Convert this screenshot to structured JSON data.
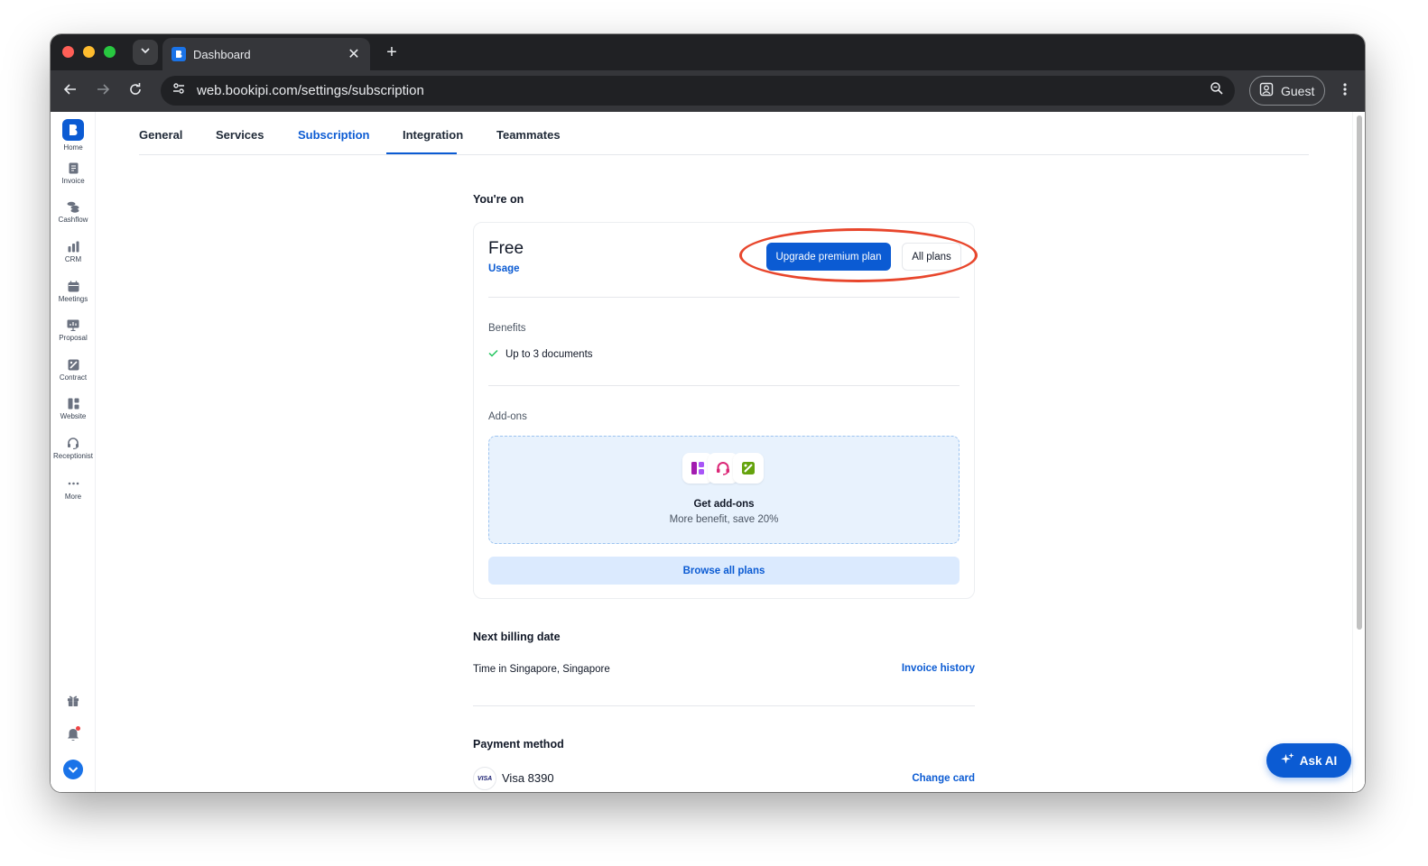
{
  "browser": {
    "tab_title": "Dashboard",
    "url": "web.bookipi.com/settings/subscription",
    "profile_label": "Guest"
  },
  "sidebar": {
    "items": [
      {
        "label": "Home",
        "icon": "bookipi-logo-icon"
      },
      {
        "label": "Invoice",
        "icon": "invoice-icon"
      },
      {
        "label": "Cashflow",
        "icon": "cashflow-icon"
      },
      {
        "label": "CRM",
        "icon": "crm-icon"
      },
      {
        "label": "Meetings",
        "icon": "meetings-icon"
      },
      {
        "label": "Proposal",
        "icon": "proposal-icon"
      },
      {
        "label": "Contract",
        "icon": "contract-icon"
      },
      {
        "label": "Website",
        "icon": "website-icon"
      },
      {
        "label": "Receptionist",
        "icon": "receptionist-icon"
      },
      {
        "label": "More",
        "icon": "more-icon"
      }
    ]
  },
  "settings_tabs": {
    "items": [
      "General",
      "Services",
      "Subscription",
      "Integration",
      "Teammates"
    ],
    "active": "Subscription"
  },
  "subscription": {
    "heading": "You're on",
    "plan_name": "Free",
    "usage_link": "Usage",
    "upgrade_button": "Upgrade premium plan",
    "all_plans_button": "All plans",
    "benefits_label": "Benefits",
    "benefits": [
      "Up to 3 documents"
    ],
    "addons_label": "Add-ons",
    "addons_title": "Get add-ons",
    "addons_subtitle": "More benefit, save 20%",
    "browse_button": "Browse all plans"
  },
  "billing": {
    "heading": "Next billing date",
    "timezone": "Time in Singapore, Singapore",
    "invoice_history_link": "Invoice history"
  },
  "payment": {
    "heading": "Payment method",
    "card_brand": "VISA",
    "card_label": "Visa 8390",
    "change_card_link": "Change card"
  },
  "ask_ai": {
    "label": "Ask AI"
  },
  "colors": {
    "accent": "#0b5bd3",
    "highlight_annotation": "#e8462c",
    "addon_bg": "#e8f2fd"
  }
}
